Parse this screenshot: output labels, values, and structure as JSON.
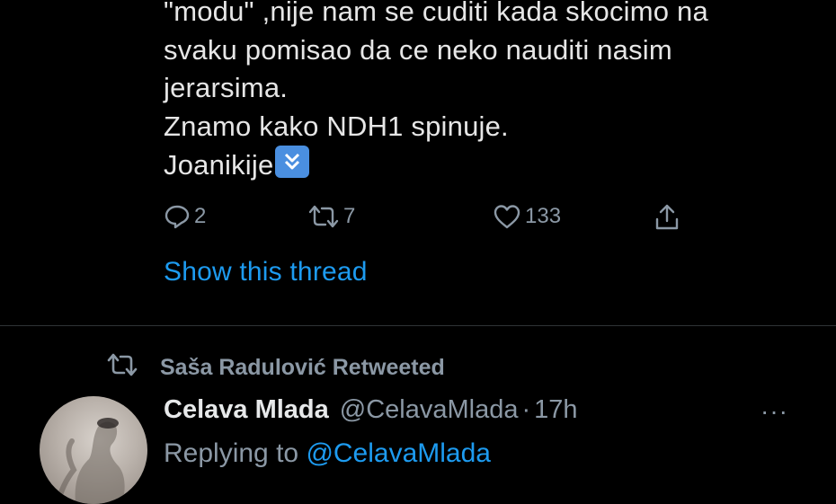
{
  "tweet": {
    "lines": [
      "\"modu\" ,nije nam se cuditi kada skocimo na",
      "svaku pomisao da ce neko nauditi nasim",
      "jerarsima.",
      "Znamo kako NDH1 spinuje.",
      "Joanikije"
    ],
    "emoji": "double-down-arrow-emoji",
    "actions": {
      "reply_count": "2",
      "retweet_count": "7",
      "like_count": "133"
    },
    "show_thread": "Show this thread"
  },
  "next_tweet": {
    "retweeted_by": "Saša Radulović Retweeted",
    "author_name": "Celava Mlada",
    "author_handle": "@CelavaMlada",
    "dot": "·",
    "time": "17h",
    "more": "···",
    "replying_prefix": "Replying to",
    "replying_mention": "@CelavaMlada"
  },
  "colors": {
    "background": "#000000",
    "text": "#e7e9ea",
    "muted": "#8b98a5",
    "accent": "#1d9bf0",
    "divider": "#2f3336"
  },
  "icons": [
    "reply-icon",
    "retweet-icon",
    "like-icon",
    "share-icon",
    "retweet-indicator-icon",
    "more-icon"
  ]
}
